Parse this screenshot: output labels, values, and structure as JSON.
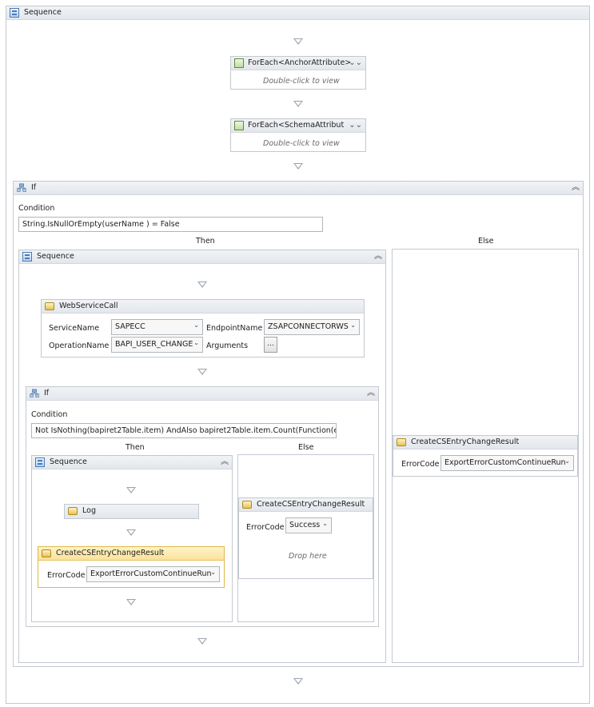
{
  "root": {
    "title": "Sequence"
  },
  "foreach1": {
    "title": "ForEach<AnchorAttribute>",
    "hint": "Double-click to view"
  },
  "foreach2": {
    "title": "ForEach<SchemaAttribute>",
    "hint": "Double-click to view"
  },
  "if_outer": {
    "title": "If",
    "condition_label": "Condition",
    "condition_value": "String.IsNullOrEmpty(userName ) = False",
    "then_label": "Then",
    "else_label": "Else"
  },
  "seq_then": {
    "title": "Sequence"
  },
  "wsc": {
    "title": "WebServiceCall",
    "service_label": "ServiceName",
    "service_value": "SAPECC",
    "endpoint_label": "EndpointName",
    "endpoint_value": "ZSAPCONNECTORWS",
    "operation_label": "OperationName",
    "operation_value": "BAPI_USER_CHANGE",
    "arguments_label": "Arguments",
    "arguments_button": "..."
  },
  "if_inner": {
    "title": "If",
    "condition_label": "Condition",
    "condition_value": "Not IsNothing(bapiret2Table.item) AndAlso bapiret2Table.item.Count(Function(errIt",
    "then_label": "Then",
    "else_label": "Else"
  },
  "seq_inner": {
    "title": "Sequence"
  },
  "log": {
    "title": "Log"
  },
  "cscr_inner_then": {
    "title": "CreateCSEntryChangeResult",
    "error_label": "ErrorCode",
    "error_value": "ExportErrorCustomContinueRun"
  },
  "cscr_inner_else": {
    "title": "CreateCSEntryChangeResult",
    "error_label": "ErrorCode",
    "error_value": "Success",
    "drop_hint": "Drop here"
  },
  "cscr_outer_else": {
    "title": "CreateCSEntryChangeResult",
    "error_label": "ErrorCode",
    "error_value": "ExportErrorCustomContinueRun"
  },
  "icons": {
    "collapse": "double-chevron-up",
    "expand": "double-chevron-down",
    "dropdown": "chevron-down"
  }
}
